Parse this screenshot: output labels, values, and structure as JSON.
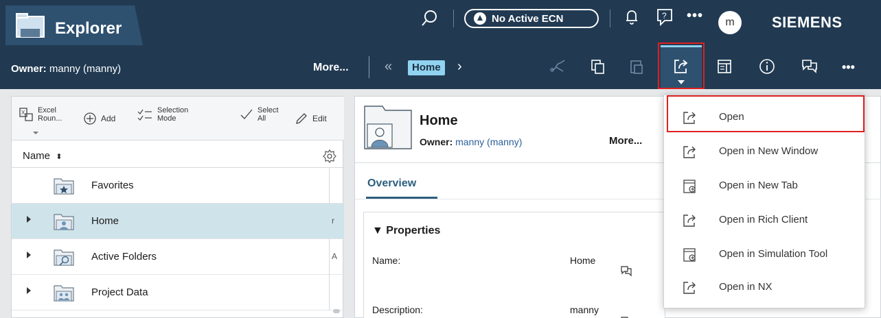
{
  "header": {
    "app_title": "Explorer",
    "ecn_label": "No Active ECN",
    "avatar_initial": "m",
    "brand": "SIEMENS",
    "more_dots": "•••",
    "icons": [
      "folder-app-icon",
      "search-icon",
      "ecn-icon",
      "bell-icon",
      "help-icon",
      "more-icon"
    ]
  },
  "context_bar": {
    "owner_label": "Owner:",
    "owner_value": "manny (manny)",
    "more_label": "More...",
    "back_glyph": "«",
    "breadcrumb": "Home",
    "forward_glyph": "›",
    "more_dots": "•••",
    "toolbar_icons": [
      "network-icon",
      "copy-icon",
      "paste-icon",
      "open-icon",
      "layout-icon",
      "info-icon",
      "chat-icon",
      "more-icon"
    ],
    "active_tool": "open-icon"
  },
  "left_panel": {
    "commands": [
      {
        "label": "Excel",
        "label2": "Roun...",
        "icon": "excel-roundtrip-icon"
      },
      {
        "label": "Add",
        "icon": "add-icon"
      },
      {
        "label": "Selection",
        "label2": "Mode",
        "icon": "selection-mode-icon"
      },
      {
        "label": "Select",
        "label2": "All",
        "icon": "select-all-icon"
      },
      {
        "label": "Edit",
        "icon": "edit-icon"
      }
    ],
    "column_header": "Name",
    "rows": [
      {
        "label": "Favorites",
        "icon": "favorites-folder-icon",
        "expandable": false,
        "selected": false
      },
      {
        "label": "Home",
        "icon": "home-folder-icon",
        "expandable": true,
        "selected": true,
        "trunc": "r"
      },
      {
        "label": "Active Folders",
        "icon": "active-folders-icon",
        "expandable": true,
        "selected": false,
        "trunc": "A"
      },
      {
        "label": "Project Data",
        "icon": "project-data-icon",
        "expandable": true,
        "selected": false
      }
    ]
  },
  "detail": {
    "title": "Home",
    "owner_label": "Owner:",
    "owner_value": "manny (manny)",
    "more_label": "More...",
    "tab": "Overview",
    "properties_title": "▼ Properties",
    "properties": [
      {
        "label": "Name:",
        "value": "Home"
      },
      {
        "label": "Description:",
        "value": "manny"
      }
    ]
  },
  "open_menu": {
    "items": [
      {
        "label": "Open",
        "icon": "open-icon",
        "highlighted": true
      },
      {
        "label": "Open in New Window",
        "icon": "open-icon"
      },
      {
        "label": "Open in New Tab",
        "icon": "new-tab-icon"
      },
      {
        "label": "Open in Rich Client",
        "icon": "open-icon"
      },
      {
        "label": "Open in Simulation Tool",
        "icon": "simulation-icon"
      },
      {
        "label": "Open in NX",
        "icon": "open-icon"
      }
    ]
  },
  "colors": {
    "header_bg": "#213a52",
    "app_tab_bg": "#2f5170",
    "accent": "#90d3f0",
    "highlight_red": "#e02020",
    "selected_row": "#cfe3ea"
  }
}
